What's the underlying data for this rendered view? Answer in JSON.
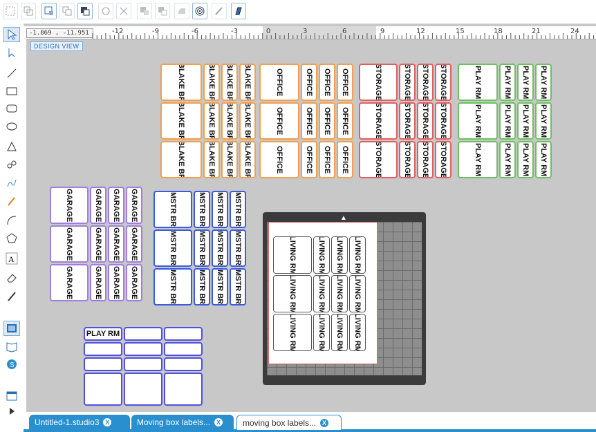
{
  "colors": {
    "orange": "#f0a050",
    "red": "#e06060",
    "green": "#6cc060",
    "purple": "#a07ee0",
    "blue": "#3a5ae0",
    "accent": "#2a8fcf"
  },
  "ruler": {
    "coord": "-1.869 , -11.951",
    "marks": [
      "-12",
      "-9",
      "-6",
      "-3",
      "0",
      "3",
      "6",
      "9",
      "12",
      "15",
      "18",
      "21",
      "24"
    ]
  },
  "canvas": {
    "design_view": "DESIGN VIEW"
  },
  "labels": {
    "blake": "BLAKE BR",
    "office": "OFFICE",
    "storage": "STORAGE",
    "playrm": "PLAY RM",
    "garage": "GARAGE",
    "mstr": "MSTR BR",
    "living": "LIVING RM",
    "playrm_h": "PLAY RM"
  },
  "toolbar_icons": [
    "group-icon",
    "ungroup-icon",
    "select-all-icon",
    "duplicate-icon",
    "arrange-icon",
    "replicate-icon",
    "delete-icon",
    "weld-icon",
    "subtract-icon",
    "offset-icon",
    "target-icon",
    "trace-icon",
    "knife-icon"
  ],
  "left_icons": [
    "pointer-icon",
    "edit-points-icon",
    "line-icon",
    "rectangle-icon",
    "rounded-rect-icon",
    "ellipse-icon",
    "polygon-icon",
    "curve-icon",
    "freehand-icon",
    "pen-icon",
    "arc-icon",
    "regular-polygon-icon",
    "text-icon",
    "eraser-icon",
    "knife-icon",
    "design-icon",
    "library-icon",
    "store-icon",
    "panel-icon",
    "expand-icon"
  ],
  "tabs": [
    {
      "label": "Untitled-1.studio3"
    },
    {
      "label": "Moving box labels..."
    },
    {
      "label": "moving box labels..."
    }
  ]
}
